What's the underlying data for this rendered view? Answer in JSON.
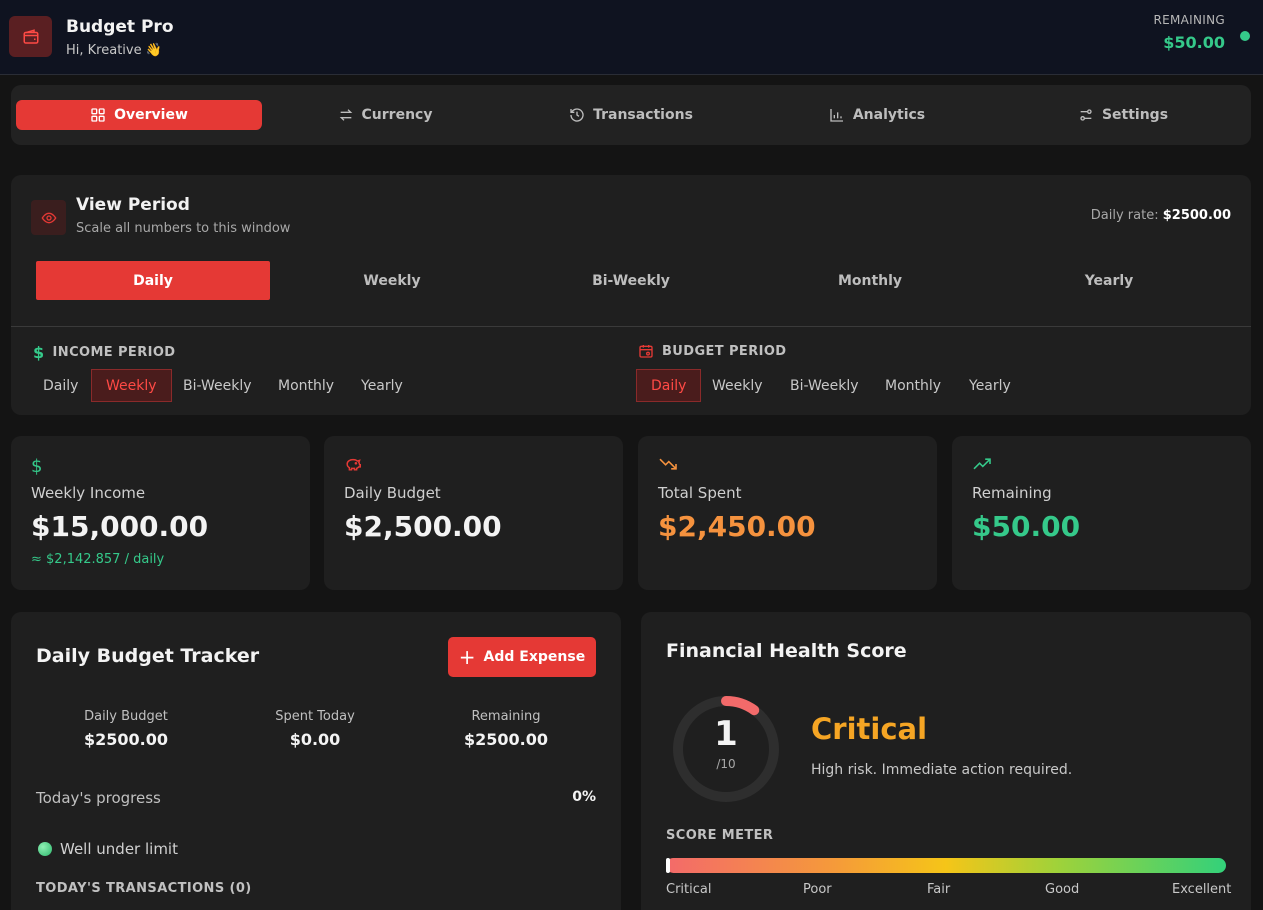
{
  "header": {
    "app_title": "Budget Pro",
    "greeting": "Hi, Kreative 👋",
    "remaining_label": "REMAINING",
    "remaining_value": "$50.00"
  },
  "nav": {
    "tabs": [
      {
        "label": "Overview",
        "icon": "grid-icon",
        "active": true
      },
      {
        "label": "Currency",
        "icon": "exchange-icon",
        "active": false
      },
      {
        "label": "Transactions",
        "icon": "history-icon",
        "active": false
      },
      {
        "label": "Analytics",
        "icon": "bar-chart-icon",
        "active": false
      },
      {
        "label": "Settings",
        "icon": "sliders-icon",
        "active": false
      }
    ]
  },
  "view_period": {
    "title": "View Period",
    "subtitle": "Scale all numbers to this window",
    "daily_rate_label": "Daily rate:",
    "daily_rate_value": "$2500.00",
    "options": [
      "Daily",
      "Weekly",
      "Bi-Weekly",
      "Monthly",
      "Yearly"
    ],
    "selected": "Daily",
    "income_period": {
      "label": "INCOME PERIOD",
      "options": [
        "Daily",
        "Weekly",
        "Bi-Weekly",
        "Monthly",
        "Yearly"
      ],
      "selected": "Weekly"
    },
    "budget_period": {
      "label": "BUDGET PERIOD",
      "options": [
        "Daily",
        "Weekly",
        "Bi-Weekly",
        "Monthly",
        "Yearly"
      ],
      "selected": "Daily"
    }
  },
  "stats": [
    {
      "label": "Weekly Income",
      "value": "$15,000.00",
      "sub": "≈ $2,142.857 / daily",
      "icon": "dollar-icon",
      "color": "#35c98a"
    },
    {
      "label": "Daily Budget",
      "value": "$2,500.00",
      "icon": "piggy-bank-icon",
      "color": "#e53935"
    },
    {
      "label": "Total Spent",
      "value": "$2,450.00",
      "icon": "trending-down-icon",
      "color": "#f5923e"
    },
    {
      "label": "Remaining",
      "value": "$50.00",
      "icon": "trending-up-icon",
      "color": "#35c98a"
    }
  ],
  "tracker": {
    "title": "Daily Budget Tracker",
    "add_button": "Add Expense",
    "columns": [
      {
        "label": "Daily Budget",
        "value": "$2500.00"
      },
      {
        "label": "Spent Today",
        "value": "$0.00"
      },
      {
        "label": "Remaining",
        "value": "$2500.00"
      }
    ],
    "progress_label": "Today's progress",
    "progress_value": "0%",
    "status": "Well under limit",
    "transactions_heading": "TODAY'S TRANSACTIONS (0)"
  },
  "health": {
    "title": "Financial Health Score",
    "score": "1",
    "score_max": "/10",
    "score_fraction": 0.1,
    "status": "Critical",
    "description": "High risk. Immediate action required.",
    "meter_heading": "SCORE METER",
    "meter_labels": [
      "Critical",
      "Poor",
      "Fair",
      "Good",
      "Excellent"
    ]
  }
}
